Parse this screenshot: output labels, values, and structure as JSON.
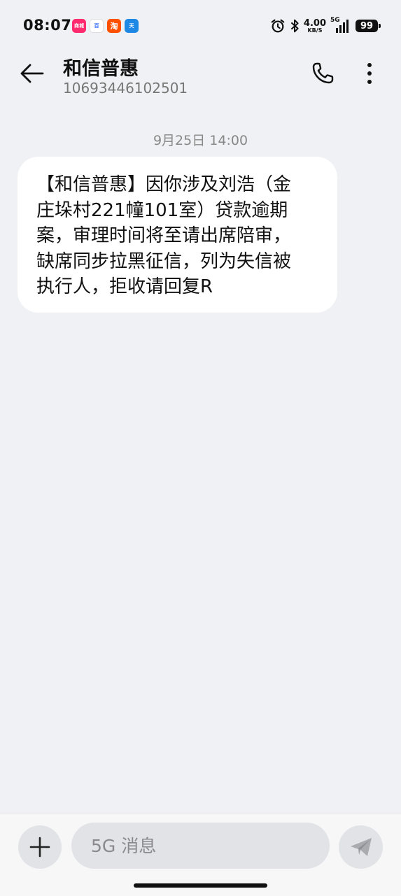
{
  "status_bar": {
    "time": "08:07",
    "app_icons": [
      {
        "name": "shop-app-icon",
        "label": "商城",
        "color": "#ff2a6d"
      },
      {
        "name": "baidu-app-icon",
        "label": "百",
        "color": "#ffffff"
      },
      {
        "name": "taobao-app-icon",
        "label": "淘",
        "color": "#ff5000"
      },
      {
        "name": "chat-app-icon",
        "label": "天",
        "color": "#1e88e5"
      }
    ],
    "network_speed": "4.00",
    "network_speed_unit": "KB/S",
    "network_type": "5G",
    "battery": "99"
  },
  "header": {
    "contact_name": "和信普惠",
    "contact_number": "10693446102501"
  },
  "conversation": {
    "timestamp": "9月25日 14:00",
    "messages": [
      {
        "lines": [
          "【和信普惠】因你涉及刘浩（金",
          "庄垛村221幢101室）贷款逾期",
          "案，审理时间将至请出席陪审，",
          "缺席同步拉黑征信，列为失信被",
          "执行人，拒收请回复R"
        ]
      }
    ]
  },
  "composer": {
    "placeholder": "5G 消息"
  },
  "colors": {
    "background": "#f0f1f4",
    "bubble": "#ffffff",
    "button_bg": "#e2e3e6"
  }
}
